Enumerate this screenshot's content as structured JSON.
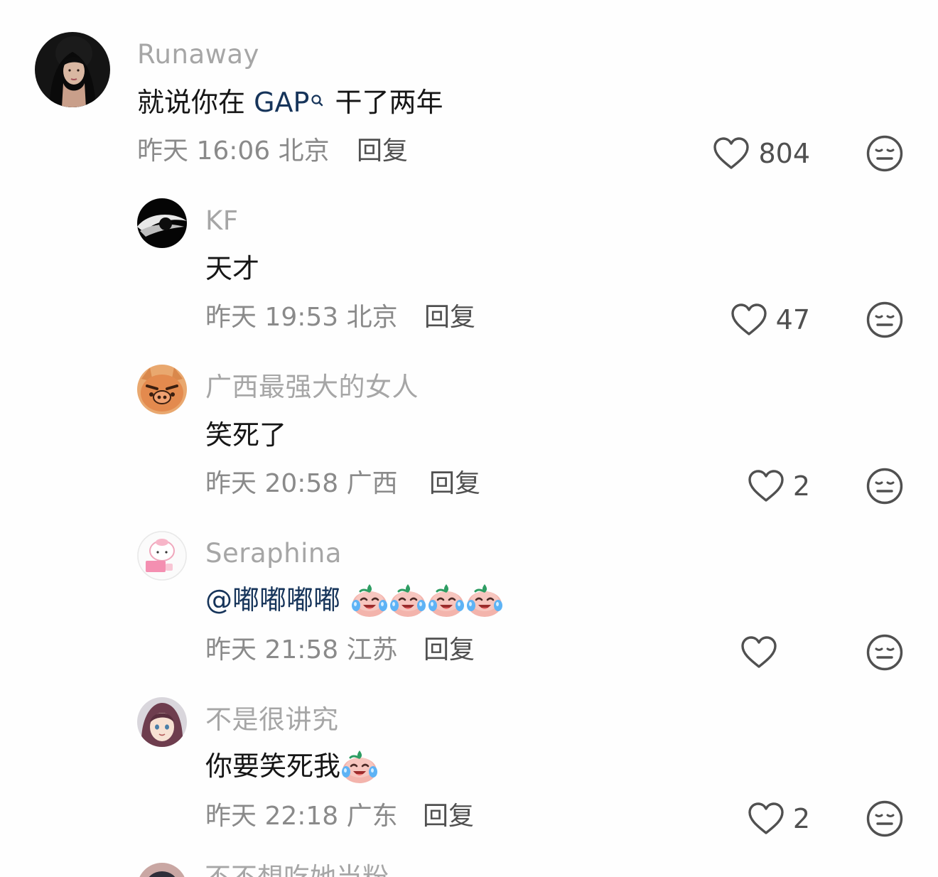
{
  "comments": [
    {
      "username": "Runaway",
      "text_before": "就说你在 ",
      "link": "GAP",
      "text_after": "干了两年",
      "time": "昨天 16:06 北京",
      "reply": "回复",
      "likes": "804"
    },
    {
      "username": "KF",
      "text": "天才",
      "time": "昨天 19:53 北京",
      "reply": "回复",
      "likes": "47"
    },
    {
      "username": "广西最强大的女人",
      "text": "笑死了",
      "time": "昨天 20:58 广西",
      "reply": "回复",
      "likes": "2"
    },
    {
      "username": "Seraphina",
      "mention": "@嘟嘟嘟嘟",
      "time": "昨天 21:58 江苏",
      "reply": "回复",
      "likes": ""
    },
    {
      "username": "不是很讲究",
      "text": "你要笑死我",
      "time": "昨天 22:18 广东",
      "reply": "回复",
      "likes": "2"
    }
  ],
  "cut_off_username": "不不想吃她当粉",
  "icons": {
    "like": "heart-outline-icon",
    "dislike": "meh-face-icon",
    "search": "search-icon",
    "emoji": "crying-laughing-peach-emoji"
  },
  "colors": {
    "username": "#a6a6a6",
    "text": "#161616",
    "meta": "#8a8a8a",
    "link": "#16345a"
  }
}
